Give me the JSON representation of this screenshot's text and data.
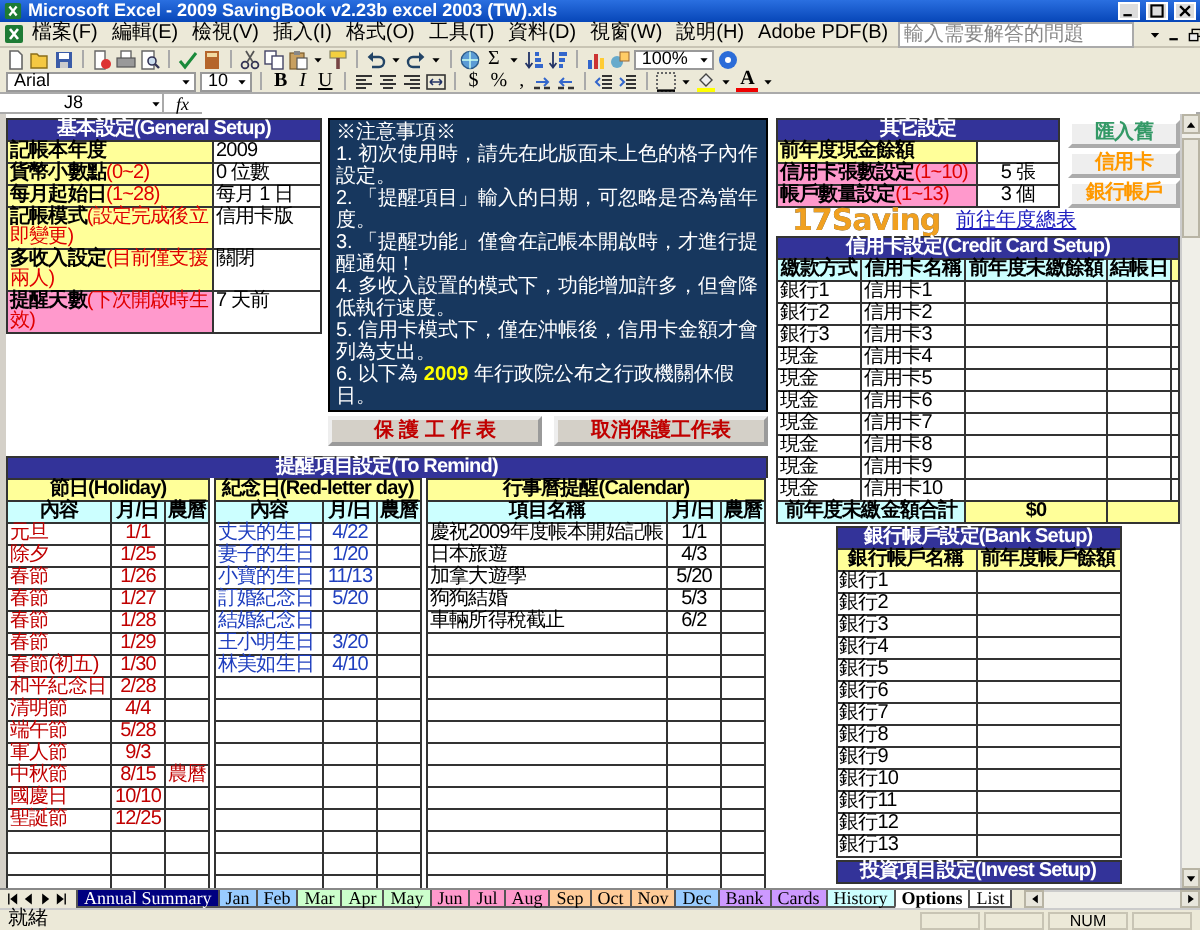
{
  "window": {
    "title": "Microsoft Excel - 2009 SavingBook v2.23b excel 2003 (TW).xls"
  },
  "menu": [
    "檔案(F)",
    "編輯(E)",
    "檢視(V)",
    "插入(I)",
    "格式(O)",
    "工具(T)",
    "資料(D)",
    "視窗(W)",
    "說明(H)",
    "Adobe PDF(B)"
  ],
  "help_box": {
    "placeholder": "輸入需要解答的問題"
  },
  "standard_toolbar": {
    "autosum": "Σ",
    "zoom": "100%"
  },
  "formatting_toolbar": {
    "font": "Arial",
    "size": "10",
    "bold": "B",
    "italic": "I",
    "underline": "U",
    "currency": "$",
    "percent": "%",
    "comma": ",",
    "font_color": "A"
  },
  "formula_bar": {
    "name_box": "J8",
    "function_label": "fx"
  },
  "general_setup": {
    "title": "基本設定(General Setup)",
    "rows": [
      {
        "label": "記帳本年度",
        "value": "2009",
        "color": "#ffff99"
      },
      {
        "label": "貨幣小數點",
        "hint": "(0~2)",
        "value": "0 位數",
        "color": "#ffff99"
      },
      {
        "label": "每月起始日",
        "hint": "(1~28)",
        "value": "每月 1 日",
        "color": "#ffff99"
      },
      {
        "label": "記帳模式",
        "hint": "(設定完成後立即變更)",
        "value": "信用卡版",
        "color": "#ffff99"
      },
      {
        "label": "多收入設定",
        "hint": "(目前僅支援兩人)",
        "value": "關閉",
        "color": "#ffff99"
      },
      {
        "label": "提醒天數",
        "hint": "(下次開啟時生效)",
        "value": "7 天前",
        "color": "#ff99cc"
      }
    ]
  },
  "notes": {
    "title": "※注意事項※",
    "lines": [
      "1. 初次使用時，請先在此版面未上色的格子內作設定。",
      "2. 「提醒項目」輸入的日期，可忽略是否為當年度。",
      "3. 「提醒功能」僅會在記帳本開啟時，才進行提醒通知！",
      "4. 多收入設置的模式下，功能增加許多，但會降低執行速度。",
      "5. 信用卡模式下，僅在沖帳後，信用卡金額才會列為支出。",
      "6. 以下為 **2009** 年行政院公布之行政機關休假日。"
    ]
  },
  "protect_buttons": [
    "保 護 工 作 表",
    "取消保護工作表"
  ],
  "reminders": {
    "title": "提醒項目設定(To Remind)",
    "tables": [
      {
        "kind": "holiday",
        "title": "節日(Holiday)",
        "columns": [
          "內容",
          "月/日",
          "農曆"
        ],
        "rows": [
          {
            "name": "元旦",
            "date": "1/1"
          },
          {
            "name": "除夕",
            "date": "1/25"
          },
          {
            "name": "春節",
            "date": "1/26"
          },
          {
            "name": "春節",
            "date": "1/27"
          },
          {
            "name": "春節",
            "date": "1/28"
          },
          {
            "name": "春節",
            "date": "1/29"
          },
          {
            "name": "春節(初五)",
            "date": "1/30"
          },
          {
            "name": "和平紀念日",
            "date": "2/28"
          },
          {
            "name": "清明節",
            "date": "4/4"
          },
          {
            "name": "端午節",
            "date": "5/28"
          },
          {
            "name": "軍人節",
            "date": "9/3"
          },
          {
            "name": "中秋節",
            "date": "8/15",
            "lunar": "農曆"
          },
          {
            "name": "國慶日",
            "date": "10/10"
          },
          {
            "name": "聖誕節",
            "date": "12/25"
          }
        ]
      },
      {
        "kind": "anniversary",
        "title": "紀念日(Red-letter day)",
        "columns": [
          "內容",
          "月/日",
          "農曆"
        ],
        "rows": [
          {
            "name": "丈夫的生日",
            "date": "4/22"
          },
          {
            "name": "妻子的生日",
            "date": "1/20"
          },
          {
            "name": "小寶的生日",
            "date": "11/13"
          },
          {
            "name": "訂婚紀念日",
            "date": "5/20"
          },
          {
            "name": "結婚紀念日"
          },
          {
            "name": "王小明生日",
            "date": "3/20"
          },
          {
            "name": "林美如生日",
            "date": "4/10"
          }
        ]
      },
      {
        "kind": "calendar",
        "title": "行事曆提醒(Calendar)",
        "columns": [
          "項目名稱",
          "月/日",
          "農曆"
        ],
        "rows": [
          {
            "name": "慶祝2009年度帳本開始記帳",
            "date": "1/1"
          },
          {
            "name": "日本旅遊",
            "date": "4/3"
          },
          {
            "name": "加拿大遊學",
            "date": "5/20"
          },
          {
            "name": "狗狗結婚",
            "date": "5/3"
          },
          {
            "name": "車輛所得稅截止",
            "date": "6/2"
          }
        ]
      }
    ]
  },
  "other_settings": {
    "title": "其它設定",
    "rows": [
      {
        "label": "前年度現金餘額",
        "color": "#ffff99"
      },
      {
        "label": "信用卡張數設定",
        "hint": "(1~10)",
        "value": "5 張",
        "color": "#ff99cc"
      },
      {
        "label": "帳戶數量設定",
        "hint": "(1~13)",
        "value": "3 個",
        "color": "#ff99cc"
      }
    ]
  },
  "side_buttons": [
    {
      "label": "匯入舊",
      "color": "#339966"
    },
    {
      "label": "信用卡",
      "color": "#ff9900"
    },
    {
      "label": "銀行帳戶",
      "color": "#ff9900"
    }
  ],
  "logo": {
    "text": "17Saving",
    "link": "前往年度總表"
  },
  "credit_cards": {
    "title": "信用卡設定(Credit Card Setup)",
    "columns": [
      "繳款方式",
      "信用卡名稱",
      "前年度未繳餘額",
      "結帳日"
    ],
    "rows": [
      {
        "method": "銀行1",
        "card": "信用卡1"
      },
      {
        "method": "銀行2",
        "card": "信用卡2"
      },
      {
        "method": "銀行3",
        "card": "信用卡3"
      },
      {
        "method": "現金",
        "card": "信用卡4"
      },
      {
        "method": "現金",
        "card": "信用卡5"
      },
      {
        "method": "現金",
        "card": "信用卡6"
      },
      {
        "method": "現金",
        "card": "信用卡7"
      },
      {
        "method": "現金",
        "card": "信用卡8"
      },
      {
        "method": "現金",
        "card": "信用卡9"
      },
      {
        "method": "現金",
        "card": "信用卡10"
      }
    ],
    "total": {
      "label": "前年度未繳金額合計",
      "value": "$0"
    }
  },
  "bank_setup": {
    "title": "銀行帳戶設定(Bank Setup)",
    "columns": [
      "銀行帳戶名稱",
      "前年度帳戶餘額"
    ],
    "rows": [
      "銀行1",
      "銀行2",
      "銀行3",
      "銀行4",
      "銀行5",
      "銀行6",
      "銀行7",
      "銀行8",
      "銀行9",
      "銀行10",
      "銀行11",
      "銀行12",
      "銀行13"
    ]
  },
  "invest_setup": {
    "title": "投資項目設定(Invest Setup)"
  },
  "sheet_tabs": [
    {
      "label": "Annual Summary",
      "color": "#000080",
      "selected": false
    },
    {
      "label": "Jan",
      "color": "#99ccff",
      "selected": false
    },
    {
      "label": "Feb",
      "color": "#99ccff",
      "selected": false
    },
    {
      "label": "Mar",
      "color": "#ccffcc",
      "selected": false
    },
    {
      "label": "Apr",
      "color": "#ccffcc",
      "selected": false
    },
    {
      "label": "May",
      "color": "#ccffcc",
      "selected": false
    },
    {
      "label": "Jun",
      "color": "#ff99cc",
      "selected": false
    },
    {
      "label": "Jul",
      "color": "#ff99cc",
      "selected": false
    },
    {
      "label": "Aug",
      "color": "#ff99cc",
      "selected": false
    },
    {
      "label": "Sep",
      "color": "#ffcc99",
      "selected": false
    },
    {
      "label": "Oct",
      "color": "#ffcc99",
      "selected": false
    },
    {
      "label": "Nov",
      "color": "#ffcc99",
      "selected": false
    },
    {
      "label": "Dec",
      "color": "#99ccff",
      "selected": false
    },
    {
      "label": "Bank",
      "color": "#cc99ff",
      "selected": false
    },
    {
      "label": "Cards",
      "color": "#cc99ff",
      "selected": false
    },
    {
      "label": "History",
      "color": "#ccffff",
      "selected": false
    },
    {
      "label": "Options",
      "color": "#ffffff",
      "selected": true
    },
    {
      "label": "List",
      "color": "#ffffff",
      "selected": false
    }
  ],
  "status_bar": {
    "message": "就緒",
    "num_lock": "NUM"
  }
}
